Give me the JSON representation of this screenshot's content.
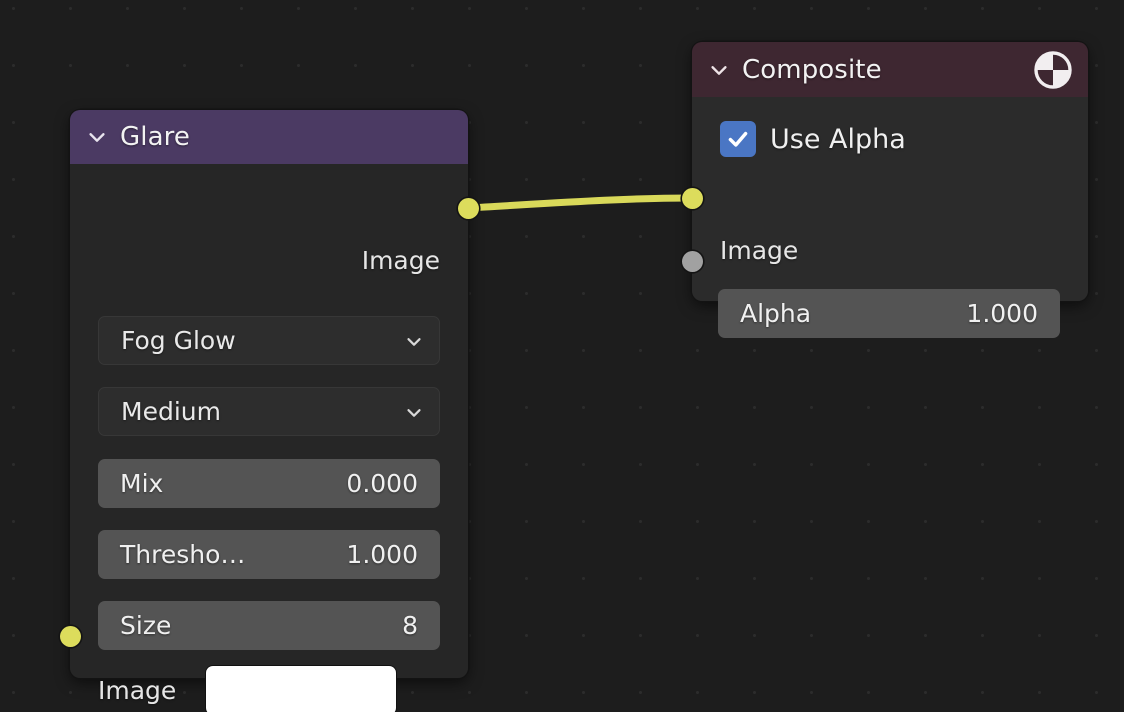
{
  "editor": {
    "name": "Blender Compositor Node Editor",
    "background_color": "#1d1d1d",
    "grid_dot_color": "#2c2c2c"
  },
  "colors": {
    "socket_image": "#dcdc5c",
    "socket_alpha": "#a1a1a1",
    "link": "#d9d95a",
    "glare_header": "#4b3a63",
    "composite_header": "#3e2731",
    "node_body": "#262626",
    "value_field": "#545454",
    "dropdown": "#2d2d2d",
    "checkbox_accent": "#4a76c4",
    "swatch": "#ffffff"
  },
  "nodes": [
    {
      "id": "glare",
      "title": "Glare",
      "collapse_icon": "chevron-down-icon",
      "outputs": [
        {
          "name": "Image",
          "label": "Image",
          "socket_color": "#dcdc5c",
          "connected": true
        }
      ],
      "properties": [
        {
          "type": "dropdown",
          "name": "glare-type",
          "value": "Fog Glow",
          "icon": "chevron-down-icon"
        },
        {
          "type": "dropdown",
          "name": "quality",
          "value": "Medium",
          "icon": "chevron-down-icon"
        },
        {
          "type": "value",
          "name": "mix",
          "label": "Mix",
          "value": "0.000"
        },
        {
          "type": "value",
          "name": "threshold",
          "label": "Thresho…",
          "value": "1.000"
        },
        {
          "type": "value",
          "name": "size",
          "label": "Size",
          "value": "8"
        }
      ],
      "inputs": [
        {
          "name": "Image",
          "label": "Image",
          "socket_color": "#dcdc5c",
          "widget": "color-swatch",
          "widget_value": "#ffffff",
          "connected": false
        }
      ]
    },
    {
      "id": "composite",
      "title": "Composite",
      "collapse_icon": "chevron-down-icon",
      "header_icon": "compositing-output-icon",
      "options": [
        {
          "type": "checkbox",
          "name": "use-alpha",
          "label": "Use Alpha",
          "checked": true
        }
      ],
      "inputs": [
        {
          "name": "Image",
          "label": "Image",
          "socket_color": "#dcdc5c",
          "connected": true
        },
        {
          "name": "Alpha",
          "label": "Alpha",
          "socket_color": "#a1a1a1",
          "widget": "value",
          "widget_value": "1.000",
          "connected": false
        }
      ]
    }
  ],
  "links": [
    {
      "name": "glare-image-to-composite-image",
      "from_node": "glare",
      "from_socket": "Image",
      "to_node": "composite",
      "to_socket": "Image",
      "color": "#d9d95a"
    }
  ]
}
